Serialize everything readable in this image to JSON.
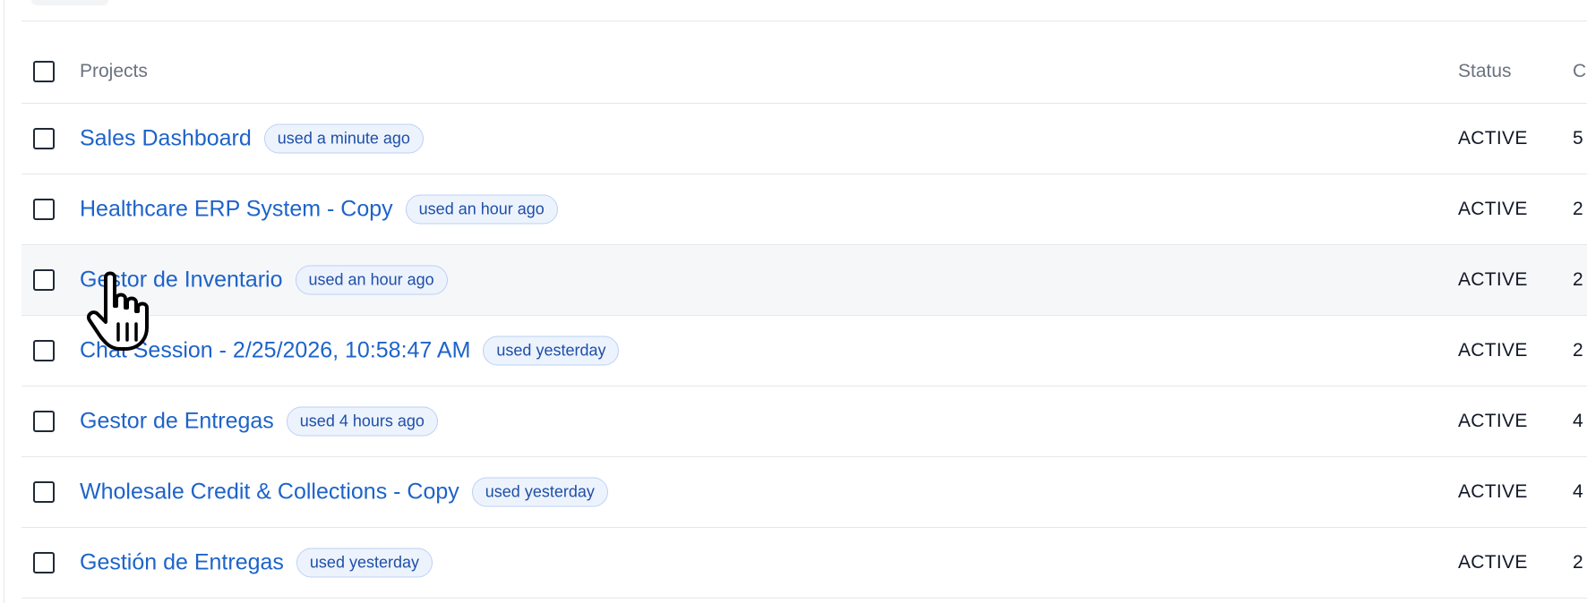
{
  "table": {
    "header": {
      "projects_label": "Projects",
      "status_label": "Status",
      "extra_label": "C"
    },
    "rows": [
      {
        "name": "Sales Dashboard",
        "badge": "used a minute ago",
        "status": "ACTIVE",
        "extra": "5"
      },
      {
        "name": "Healthcare ERP System - Copy",
        "badge": "used an hour ago",
        "status": "ACTIVE",
        "extra": "2"
      },
      {
        "name": "Gestor de Inventario",
        "badge": "used an hour ago",
        "status": "ACTIVE",
        "extra": "2"
      },
      {
        "name": "Chat Session - 2/25/2026, 10:58:47 AM",
        "badge": "used yesterday",
        "status": "ACTIVE",
        "extra": "2"
      },
      {
        "name": "Gestor de Entregas",
        "badge": "used 4 hours ago",
        "status": "ACTIVE",
        "extra": "4"
      },
      {
        "name": "Wholesale Credit & Collections - Copy",
        "badge": "used yesterday",
        "status": "ACTIVE",
        "extra": "4"
      },
      {
        "name": "Gestión de Entregas",
        "badge": "used yesterday",
        "status": "ACTIVE",
        "extra": "2"
      }
    ]
  },
  "cursor": {
    "icon": "hand-pointer-icon",
    "hovered_row": 2
  },
  "colors": {
    "link": "#1d63c9",
    "badge_bg": "#edf3fd",
    "badge_border": "#bcd0f3",
    "hover_row": "#f6f7f9"
  }
}
